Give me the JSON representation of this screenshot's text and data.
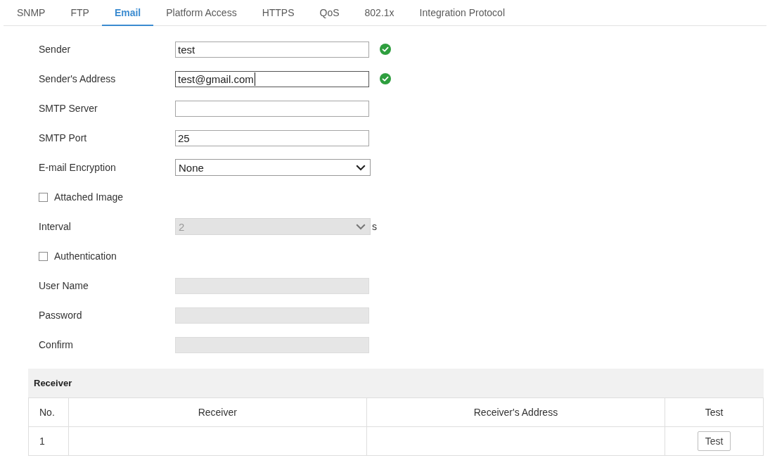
{
  "tabs": [
    {
      "label": "SNMP",
      "selected": false
    },
    {
      "label": "FTP",
      "selected": false
    },
    {
      "label": "Email",
      "selected": true
    },
    {
      "label": "Platform Access",
      "selected": false
    },
    {
      "label": "HTTPS",
      "selected": false
    },
    {
      "label": "QoS",
      "selected": false
    },
    {
      "label": "802.1x",
      "selected": false
    },
    {
      "label": "Integration Protocol",
      "selected": false
    }
  ],
  "form": {
    "fields": [
      {
        "kind": "text",
        "label": "Sender",
        "value": "test",
        "disabled": false,
        "focused": false,
        "valid": true
      },
      {
        "kind": "text",
        "label": "Sender's Address",
        "value": "test@gmail.com",
        "disabled": false,
        "focused": true,
        "valid": true
      },
      {
        "kind": "text",
        "label": "SMTP Server",
        "disabled": false,
        "focused": false,
        "valid": false
      },
      {
        "kind": "text",
        "label": "SMTP Port",
        "value": "25",
        "disabled": false,
        "focused": false,
        "valid": false
      },
      {
        "kind": "select",
        "label": "E-mail Encryption",
        "value": "None",
        "disabled": false
      },
      {
        "kind": "checkbox",
        "label": "Attached Image",
        "checked": false
      },
      {
        "kind": "select",
        "label": "Interval",
        "value": "2",
        "unit": "s",
        "disabled": true
      },
      {
        "kind": "checkbox",
        "label": "Authentication",
        "checked": false
      },
      {
        "kind": "text",
        "label": "User Name",
        "disabled": true,
        "focused": false,
        "valid": false
      },
      {
        "kind": "text",
        "label": "Password",
        "disabled": true,
        "focused": false,
        "valid": false
      },
      {
        "kind": "text",
        "label": "Confirm",
        "disabled": true,
        "focused": false,
        "valid": false
      }
    ]
  },
  "receiver": {
    "title": "Receiver",
    "columns": [
      "No.",
      "Receiver",
      "Receiver's Address",
      "Test"
    ],
    "rows": [
      {
        "no": "1",
        "test_button": "Test"
      }
    ]
  }
}
